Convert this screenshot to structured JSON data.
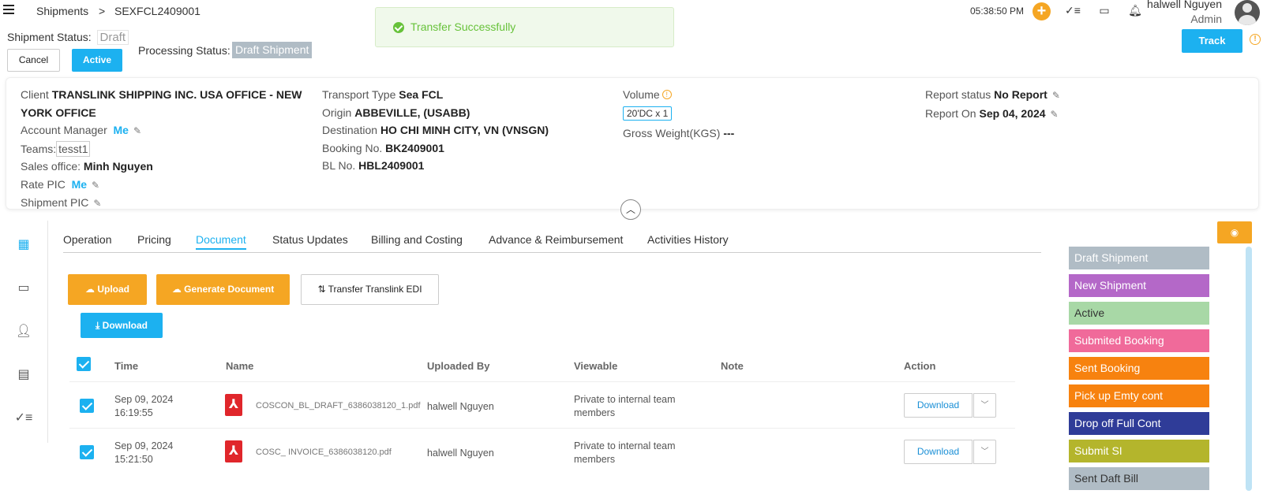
{
  "breadcrumb": {
    "root": "Shipments",
    "sep": ">",
    "current": "SEXFCL2409001"
  },
  "toast": {
    "message": "Transfer Successfully"
  },
  "header": {
    "time": "05:38:50 PM",
    "user_name": "halwell Nguyen",
    "user_role": "Admin"
  },
  "status": {
    "shipment_label": "Shipment Status:",
    "shipment_value": "Draft",
    "processing_label": "Processing Status:",
    "processing_value": "Draft Shipment",
    "cancel": "Cancel",
    "active": "Active",
    "track": "Track"
  },
  "info": {
    "client_label": "Client",
    "client_value_1": "TRANSLINK SHIPPING INC. USA OFFICE - NEW",
    "client_value_2": "YORK OFFICE",
    "account_manager_label": "Account Manager",
    "account_manager_value": "Me",
    "teams_label": "Teams:",
    "teams_value": "tesst1",
    "sales_office_label": "Sales office:",
    "sales_office_value": "Minh Nguyen",
    "rate_pic_label": "Rate PIC",
    "rate_pic_value": "Me",
    "shipment_pic_label": "Shipment PIC",
    "transport_type_label": "Transport Type",
    "transport_type_value": "Sea FCL",
    "origin_label": "Origin",
    "origin_value": "ABBEVILLE, (USABB)",
    "destination_label": "Destination",
    "destination_value": "HO CHI MINH CITY, VN (VNSGN)",
    "booking_label": "Booking No.",
    "booking_value": "BK2409001",
    "bl_label": "BL No.",
    "bl_value": "HBL2409001",
    "volume_label": "Volume",
    "volume_value": "20'DC x 1",
    "gross_weight_label": "Gross Weight(KGS)",
    "gross_weight_value": "---",
    "report_status_label": "Report status",
    "report_status_value": "No Report",
    "report_on_label": "Report On",
    "report_on_value": "Sep 04, 2024"
  },
  "tabs": [
    {
      "label": "Operation"
    },
    {
      "label": "Pricing"
    },
    {
      "label": "Document"
    },
    {
      "label": "Status Updates"
    },
    {
      "label": "Billing and Costing"
    },
    {
      "label": "Advance & Reimbursement"
    },
    {
      "label": "Activities History"
    }
  ],
  "actions": {
    "upload": "Upload",
    "generate": "Generate Document",
    "transfer_edi": "Transfer Translink EDI",
    "download": "Download"
  },
  "table": {
    "headers": {
      "time": "Time",
      "name": "Name",
      "uploaded_by": "Uploaded By",
      "viewable": "Viewable",
      "note": "Note",
      "action": "Action"
    },
    "rows": [
      {
        "date": "Sep 09, 2024",
        "time": "16:19:55",
        "name": "COSCON_BL_DRAFT_6386038120_1.pdf",
        "uploaded_by": "halwell Nguyen",
        "viewable_1": "Private to internal team",
        "viewable_2": "members",
        "action": "Download"
      },
      {
        "date": "Sep 09, 2024",
        "time": "15:21:50",
        "name": "COSC_ INVOICE_6386038120.pdf",
        "uploaded_by": "halwell Nguyen",
        "viewable_1": "Private to internal team",
        "viewable_2": "members",
        "action": "Download"
      }
    ]
  },
  "legend": [
    {
      "label": "Draft Shipment",
      "color": "#b0bcc5"
    },
    {
      "label": "New Shipment",
      "color": "#b468c8"
    },
    {
      "label": "Active",
      "color": "#a8d8a6"
    },
    {
      "label": "Submited Booking",
      "color": "#f06a9a"
    },
    {
      "label": "Sent Booking",
      "color": "#f7820f"
    },
    {
      "label": "Pick up Emty cont",
      "color": "#f7820f"
    },
    {
      "label": "Drop off Full Cont",
      "color": "#2f3c98"
    },
    {
      "label": "Submit SI",
      "color": "#b4b52c"
    },
    {
      "label": "Sent Daft Bill",
      "color": "#b0bcc5"
    }
  ]
}
